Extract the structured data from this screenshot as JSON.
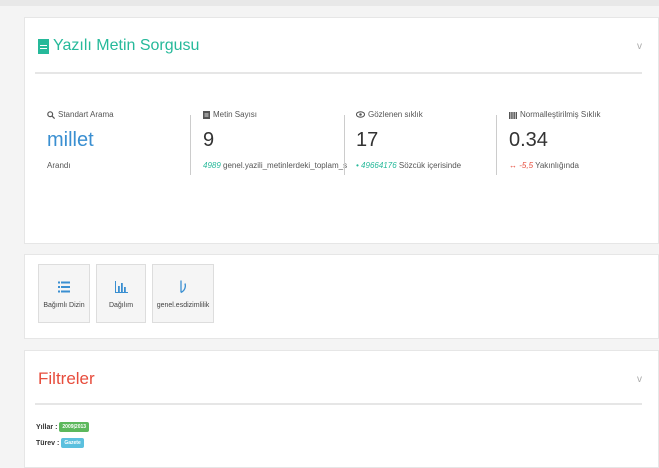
{
  "query_panel": {
    "title": "Yazılı Metin Sorgusu",
    "collapse_glyph": "v",
    "stats": [
      {
        "icon": "search-icon",
        "label": "Standart Arama",
        "value": "millet",
        "sub_text": "Arandı"
      },
      {
        "icon": "document-icon",
        "label": "Metin Sayısı",
        "value": "9",
        "sub_number": "4989",
        "sub_text": "genel.yazili_metinlerdeki_toplam_s"
      },
      {
        "icon": "eye-icon",
        "label": "Gözlenen sıklık",
        "value": "17",
        "sub_prefix": "•",
        "sub_number": "49664176",
        "sub_text": "Sözcük içerisinde"
      },
      {
        "icon": "bar-chart-icon",
        "label": "Normalleştirilmiş Sıklık",
        "value": "0.34",
        "sub_prefix": "↔",
        "sub_number": "-5,5",
        "sub_text": "Yakınlığında"
      }
    ]
  },
  "tools": [
    {
      "icon": "list-icon",
      "label": "Bağımlı Dizin"
    },
    {
      "icon": "distribution-chart-icon",
      "label": "Dağılım"
    },
    {
      "icon": "collocation-icon",
      "label": "genel.esdizimlilik"
    }
  ],
  "filters_panel": {
    "title": "Filtreler",
    "collapse_glyph": "v",
    "rows": [
      {
        "label": "Yıllar :",
        "badge": "2009|2013",
        "badge_color": "#5cb85c"
      },
      {
        "label": "Türev :",
        "badge": "Gazete",
        "badge_color": "#5bc0de"
      }
    ]
  }
}
